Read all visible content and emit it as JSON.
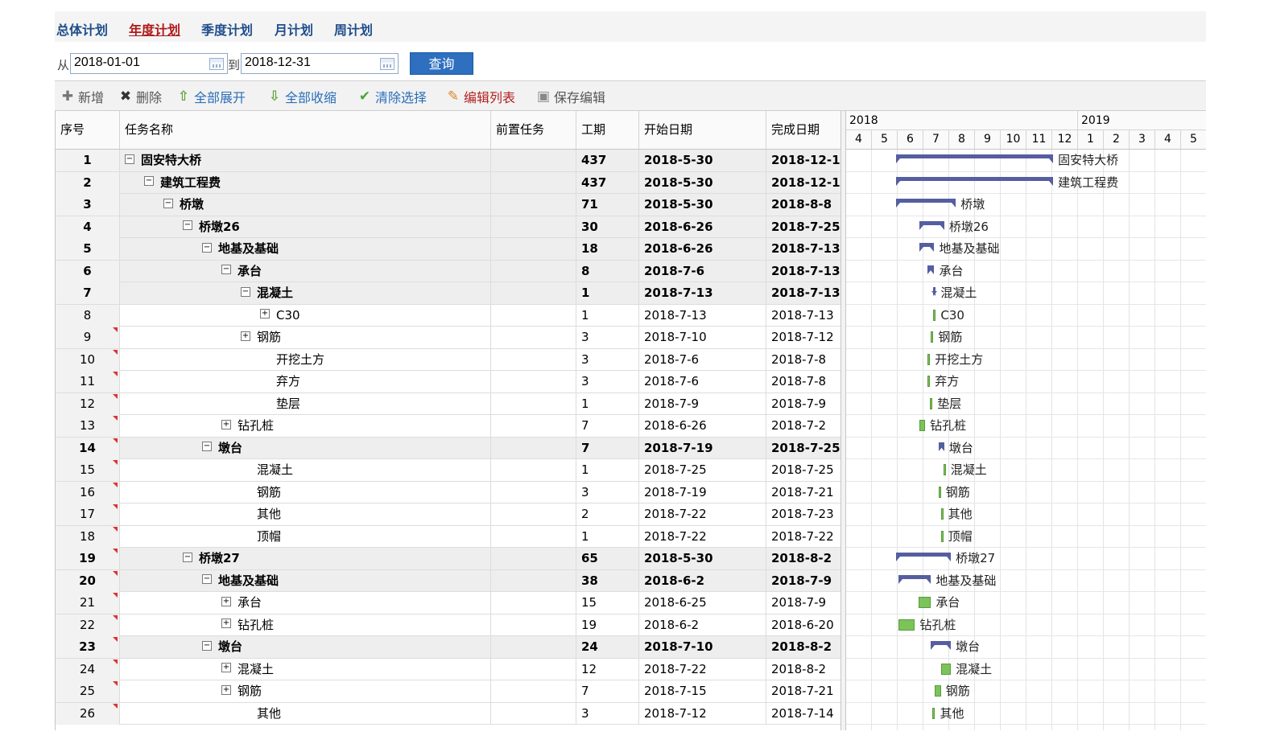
{
  "plan_tabs": [
    {
      "label": "总体计划",
      "active": false
    },
    {
      "label": "年度计划",
      "active": true
    },
    {
      "label": "季度计划",
      "active": false
    },
    {
      "label": "月计划",
      "active": false
    },
    {
      "label": "周计划",
      "active": false
    }
  ],
  "query": {
    "from_label": "从",
    "from_value": "2018-01-01",
    "to_label": "到",
    "to_value": "2018-12-31",
    "button_label": "查询"
  },
  "toolbar": {
    "add": "新增",
    "delete": "删除",
    "expand_all": "全部展开",
    "collapse_all": "全部收缩",
    "clear_selection": "清除选择",
    "edit_list": "编辑列表",
    "save_edit": "保存编辑"
  },
  "columns": {
    "index": "序号",
    "name": "任务名称",
    "predecessor": "前置任务",
    "duration": "工期",
    "start": "开始日期",
    "end": "完成日期"
  },
  "gantt": {
    "years": [
      "2018",
      "2019"
    ],
    "months": [
      "4",
      "5",
      "6",
      "7",
      "8",
      "9",
      "10",
      "11",
      "12",
      "1",
      "2",
      "3",
      "4",
      "5"
    ],
    "summary_color": "#555ea0",
    "task_color": "#7cc35a"
  },
  "rows": [
    {
      "idx": "1",
      "name": "固安特大桥",
      "pre": "",
      "dur": "437",
      "start": "2018-5-30",
      "end": "2018-12-1",
      "level": 0,
      "summary": true,
      "toggle": "⊟",
      "dirty": false
    },
    {
      "idx": "2",
      "name": "建筑工程费",
      "pre": "",
      "dur": "437",
      "start": "2018-5-30",
      "end": "2018-12-1",
      "level": 1,
      "summary": true,
      "toggle": "⊟",
      "dirty": false
    },
    {
      "idx": "3",
      "name": "桥墩",
      "pre": "",
      "dur": "71",
      "start": "2018-5-30",
      "end": "2018-8-8",
      "level": 2,
      "summary": true,
      "toggle": "⊟",
      "dirty": false
    },
    {
      "idx": "4",
      "name": "桥墩26",
      "pre": "",
      "dur": "30",
      "start": "2018-6-26",
      "end": "2018-7-25",
      "level": 3,
      "summary": true,
      "toggle": "⊟",
      "dirty": false
    },
    {
      "idx": "5",
      "name": "地基及基础",
      "pre": "",
      "dur": "18",
      "start": "2018-6-26",
      "end": "2018-7-13",
      "level": 4,
      "summary": true,
      "toggle": "⊟",
      "dirty": false
    },
    {
      "idx": "6",
      "name": "承台",
      "pre": "",
      "dur": "8",
      "start": "2018-7-6",
      "end": "2018-7-13",
      "level": 5,
      "summary": true,
      "toggle": "⊟",
      "dirty": false
    },
    {
      "idx": "7",
      "name": "混凝土",
      "pre": "",
      "dur": "1",
      "start": "2018-7-13",
      "end": "2018-7-13",
      "level": 6,
      "summary": true,
      "toggle": "⊟",
      "dirty": false
    },
    {
      "idx": "8",
      "name": "C30",
      "pre": "",
      "dur": "1",
      "start": "2018-7-13",
      "end": "2018-7-13",
      "level": 7,
      "summary": false,
      "toggle": "⊞",
      "dirty": false
    },
    {
      "idx": "9",
      "name": "钢筋",
      "pre": "",
      "dur": "3",
      "start": "2018-7-10",
      "end": "2018-7-12",
      "level": 6,
      "summary": false,
      "toggle": "⊞",
      "dirty": true
    },
    {
      "idx": "10",
      "name": "开挖土方",
      "pre": "",
      "dur": "3",
      "start": "2018-7-6",
      "end": "2018-7-8",
      "level": 7,
      "summary": false,
      "toggle": "",
      "dirty": true
    },
    {
      "idx": "11",
      "name": "弃方",
      "pre": "",
      "dur": "3",
      "start": "2018-7-6",
      "end": "2018-7-8",
      "level": 7,
      "summary": false,
      "toggle": "",
      "dirty": true
    },
    {
      "idx": "12",
      "name": "垫层",
      "pre": "",
      "dur": "1",
      "start": "2018-7-9",
      "end": "2018-7-9",
      "level": 7,
      "summary": false,
      "toggle": "",
      "dirty": true
    },
    {
      "idx": "13",
      "name": "钻孔桩",
      "pre": "",
      "dur": "7",
      "start": "2018-6-26",
      "end": "2018-7-2",
      "level": 5,
      "summary": false,
      "toggle": "⊞",
      "dirty": true
    },
    {
      "idx": "14",
      "name": "墩台",
      "pre": "",
      "dur": "7",
      "start": "2018-7-19",
      "end": "2018-7-25",
      "level": 4,
      "summary": true,
      "toggle": "⊟",
      "dirty": true
    },
    {
      "idx": "15",
      "name": "混凝土",
      "pre": "",
      "dur": "1",
      "start": "2018-7-25",
      "end": "2018-7-25",
      "level": 6,
      "summary": false,
      "toggle": "",
      "dirty": true
    },
    {
      "idx": "16",
      "name": "钢筋",
      "pre": "",
      "dur": "3",
      "start": "2018-7-19",
      "end": "2018-7-21",
      "level": 6,
      "summary": false,
      "toggle": "",
      "dirty": true
    },
    {
      "idx": "17",
      "name": "其他",
      "pre": "",
      "dur": "2",
      "start": "2018-7-22",
      "end": "2018-7-23",
      "level": 6,
      "summary": false,
      "toggle": "",
      "dirty": true
    },
    {
      "idx": "18",
      "name": "顶帽",
      "pre": "",
      "dur": "1",
      "start": "2018-7-22",
      "end": "2018-7-22",
      "level": 6,
      "summary": false,
      "toggle": "",
      "dirty": true
    },
    {
      "idx": "19",
      "name": "桥墩27",
      "pre": "",
      "dur": "65",
      "start": "2018-5-30",
      "end": "2018-8-2",
      "level": 3,
      "summary": true,
      "toggle": "⊟",
      "dirty": true
    },
    {
      "idx": "20",
      "name": "地基及基础",
      "pre": "",
      "dur": "38",
      "start": "2018-6-2",
      "end": "2018-7-9",
      "level": 4,
      "summary": true,
      "toggle": "⊟",
      "dirty": true
    },
    {
      "idx": "21",
      "name": "承台",
      "pre": "",
      "dur": "15",
      "start": "2018-6-25",
      "end": "2018-7-9",
      "level": 5,
      "summary": false,
      "toggle": "⊞",
      "dirty": true
    },
    {
      "idx": "22",
      "name": "钻孔桩",
      "pre": "",
      "dur": "19",
      "start": "2018-6-2",
      "end": "2018-6-20",
      "level": 5,
      "summary": false,
      "toggle": "⊞",
      "dirty": true
    },
    {
      "idx": "23",
      "name": "墩台",
      "pre": "",
      "dur": "24",
      "start": "2018-7-10",
      "end": "2018-8-2",
      "level": 4,
      "summary": true,
      "toggle": "⊟",
      "dirty": true
    },
    {
      "idx": "24",
      "name": "混凝土",
      "pre": "",
      "dur": "12",
      "start": "2018-7-22",
      "end": "2018-8-2",
      "level": 5,
      "summary": false,
      "toggle": "⊞",
      "dirty": true
    },
    {
      "idx": "25",
      "name": "钢筋",
      "pre": "",
      "dur": "7",
      "start": "2018-7-15",
      "end": "2018-7-21",
      "level": 5,
      "summary": false,
      "toggle": "⊞",
      "dirty": true
    },
    {
      "idx": "26",
      "name": "其他",
      "pre": "",
      "dur": "3",
      "start": "2018-7-12",
      "end": "2018-7-14",
      "level": 6,
      "summary": false,
      "toggle": "",
      "dirty": true
    }
  ]
}
